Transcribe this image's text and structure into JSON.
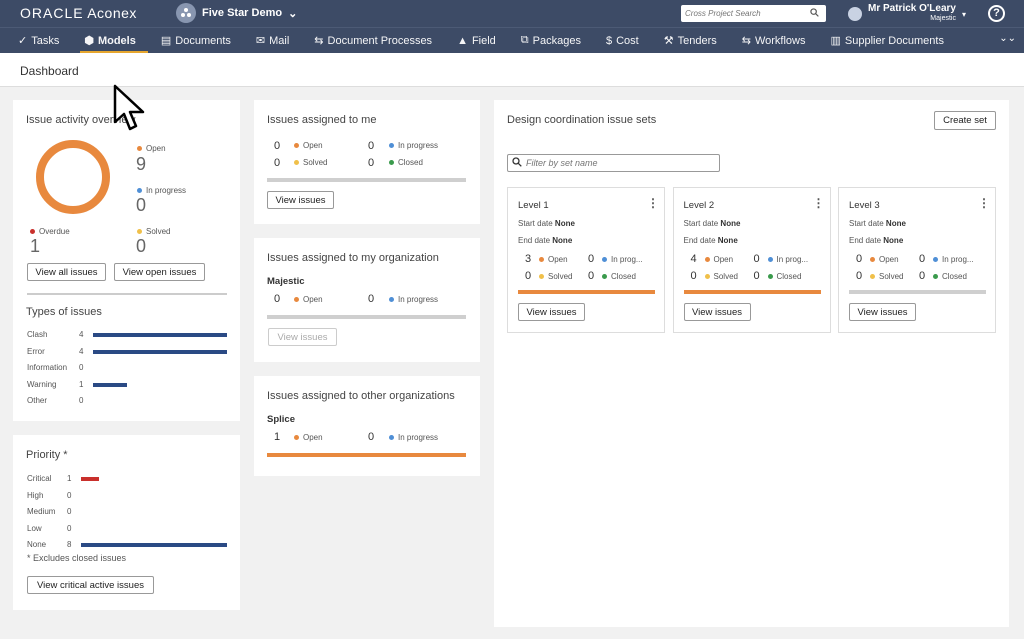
{
  "header": {
    "logo_brand": "ORACLE",
    "logo_product": "Aconex",
    "project_name": "Five Star Demo",
    "search_placeholder": "Cross Project Search",
    "user_name": "Mr Patrick O'Leary",
    "user_org": "Majestic",
    "help_label": "?"
  },
  "nav": [
    {
      "label": "Tasks",
      "icon": "check-icon"
    },
    {
      "label": "Models",
      "icon": "cube-icon",
      "active": true
    },
    {
      "label": "Documents",
      "icon": "document-icon"
    },
    {
      "label": "Mail",
      "icon": "mail-icon"
    },
    {
      "label": "Document Processes",
      "icon": "workflow-icon"
    },
    {
      "label": "Field",
      "icon": "field-icon"
    },
    {
      "label": "Packages",
      "icon": "packages-icon"
    },
    {
      "label": "Cost",
      "icon": "cost-icon"
    },
    {
      "label": "Tenders",
      "icon": "tenders-icon"
    },
    {
      "label": "Workflows",
      "icon": "workflows-icon"
    },
    {
      "label": "Supplier Documents",
      "icon": "supplier-icon"
    }
  ],
  "page_title": "Dashboard",
  "activity": {
    "title": "Issue activity overview",
    "open_label": "Open",
    "open_value": "9",
    "inprogress_label": "In progress",
    "inprogress_value": "0",
    "overdue_label": "Overdue",
    "overdue_value": "1",
    "solved_label": "Solved",
    "solved_value": "0",
    "view_all": "View all issues",
    "view_open": "View open issues"
  },
  "types": {
    "title": "Types of issues",
    "rows": [
      {
        "label": "Clash",
        "value": "4",
        "fraction": 1.0
      },
      {
        "label": "Error",
        "value": "4",
        "fraction": 1.0
      },
      {
        "label": "Information",
        "value": "0",
        "fraction": 0
      },
      {
        "label": "Warning",
        "value": "1",
        "fraction": 0.25
      },
      {
        "label": "Other",
        "value": "0",
        "fraction": 0
      }
    ]
  },
  "priority": {
    "title": "Priority *",
    "rows": [
      {
        "label": "Critical",
        "value": "1",
        "fraction": 0.125
      },
      {
        "label": "High",
        "value": "0",
        "fraction": 0
      },
      {
        "label": "Medium",
        "value": "0",
        "fraction": 0
      },
      {
        "label": "Low",
        "value": "0",
        "fraction": 0
      },
      {
        "label": "None",
        "value": "8",
        "fraction": 1.0
      }
    ],
    "note": "* Excludes closed issues",
    "button": "View critical active issues"
  },
  "assigned_me": {
    "title": "Issues assigned to me",
    "open_value": "0",
    "open_label": "Open",
    "inprogress_value": "0",
    "inprogress_label": "In progress",
    "solved_value": "0",
    "solved_label": "Solved",
    "closed_value": "0",
    "closed_label": "Closed",
    "button": "View issues"
  },
  "assigned_org": {
    "title": "Issues assigned to my organization",
    "org": "Majestic",
    "open_value": "0",
    "open_label": "Open",
    "inprogress_value": "0",
    "inprogress_label": "In progress",
    "button": "View issues"
  },
  "assigned_other": {
    "title": "Issues assigned to other organizations",
    "org": "Splice",
    "open_value": "1",
    "open_label": "Open",
    "inprogress_value": "0",
    "inprogress_label": "In progress"
  },
  "design": {
    "title": "Design coordination issue sets",
    "create_button": "Create set",
    "filter_placeholder": "Filter by set name",
    "levels": [
      {
        "name": "Level 1",
        "start_label": "Start date",
        "start": "None",
        "end_label": "End date",
        "end": "None",
        "open": "3",
        "inprog": "0",
        "solved": "0",
        "closed": "0",
        "has_open": true,
        "button": "View issues"
      },
      {
        "name": "Level 2",
        "start_label": "Start date",
        "start": "None",
        "end_label": "End date",
        "end": "None",
        "open": "4",
        "inprog": "0",
        "solved": "0",
        "closed": "0",
        "has_open": true,
        "button": "View issues"
      },
      {
        "name": "Level 3",
        "start_label": "Start date",
        "start": "None",
        "end_label": "End date",
        "end": "None",
        "open": "0",
        "inprog": "0",
        "solved": "0",
        "closed": "0",
        "has_open": false,
        "button": "View issues"
      }
    ],
    "open_label": "Open",
    "inprog_label": "In prog...",
    "solved_label": "Solved",
    "closed_label": "Closed"
  },
  "colors": {
    "header_bg": "#3d4b66",
    "accent": "#f0ab2d",
    "open": "#e8893e",
    "in_progress": "#4f8fd6",
    "solved": "#f0c04a",
    "closed": "#3a9a4c",
    "overdue": "#c9302c",
    "bar": "#2a4a84"
  }
}
